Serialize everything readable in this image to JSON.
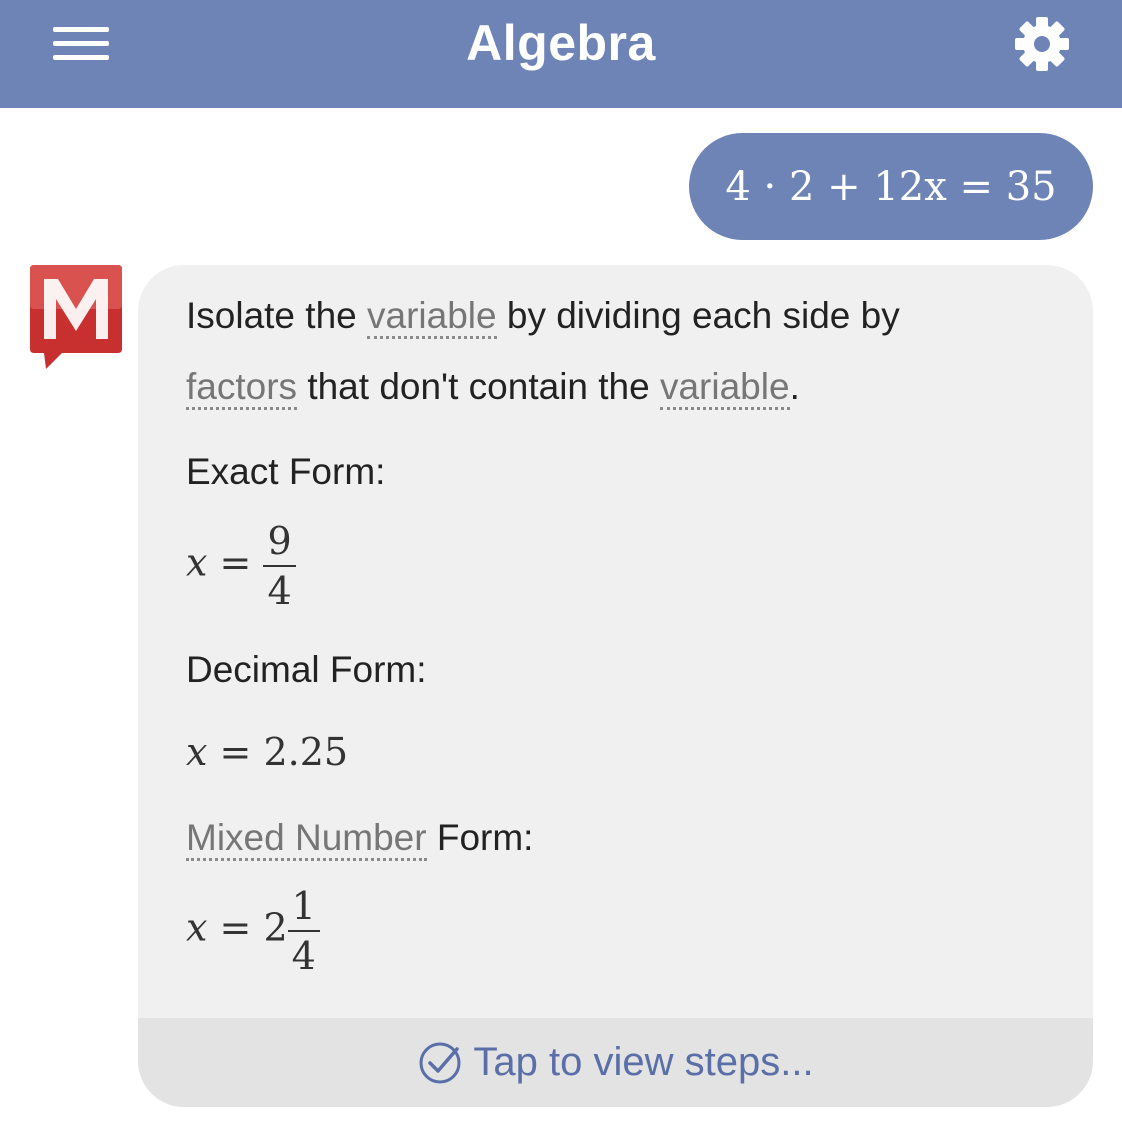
{
  "header": {
    "title": "Algebra",
    "menu_icon": "hamburger-menu-icon",
    "settings_icon": "gear-icon",
    "color": "#6e83b6"
  },
  "question": {
    "expression": "4 · 2 + 12x = 35"
  },
  "avatar": {
    "icon": "mathway-logo-icon",
    "letter": "M",
    "color": "#c8302f"
  },
  "answer": {
    "explanation": {
      "line1_pre": "Isolate the ",
      "line1_link": "variable",
      "line1_post": " by dividing each side by",
      "line2_link1": "factors",
      "line2_mid": " that don't contain the ",
      "line2_link2": "variable",
      "line2_post": "."
    },
    "exact": {
      "label": "Exact Form:",
      "var": "x",
      "eq": "=",
      "numerator": "9",
      "denominator": "4"
    },
    "decimal": {
      "label": "Decimal Form:",
      "var": "x",
      "eq": "=",
      "value": "2.25"
    },
    "mixed": {
      "label_link": "Mixed Number",
      "label_post": " Form:",
      "var": "x",
      "eq": "=",
      "whole": "2",
      "numerator": "1",
      "denominator": "4"
    },
    "steps": {
      "label": "Tap to view steps...",
      "icon": "check-circle-icon"
    }
  }
}
